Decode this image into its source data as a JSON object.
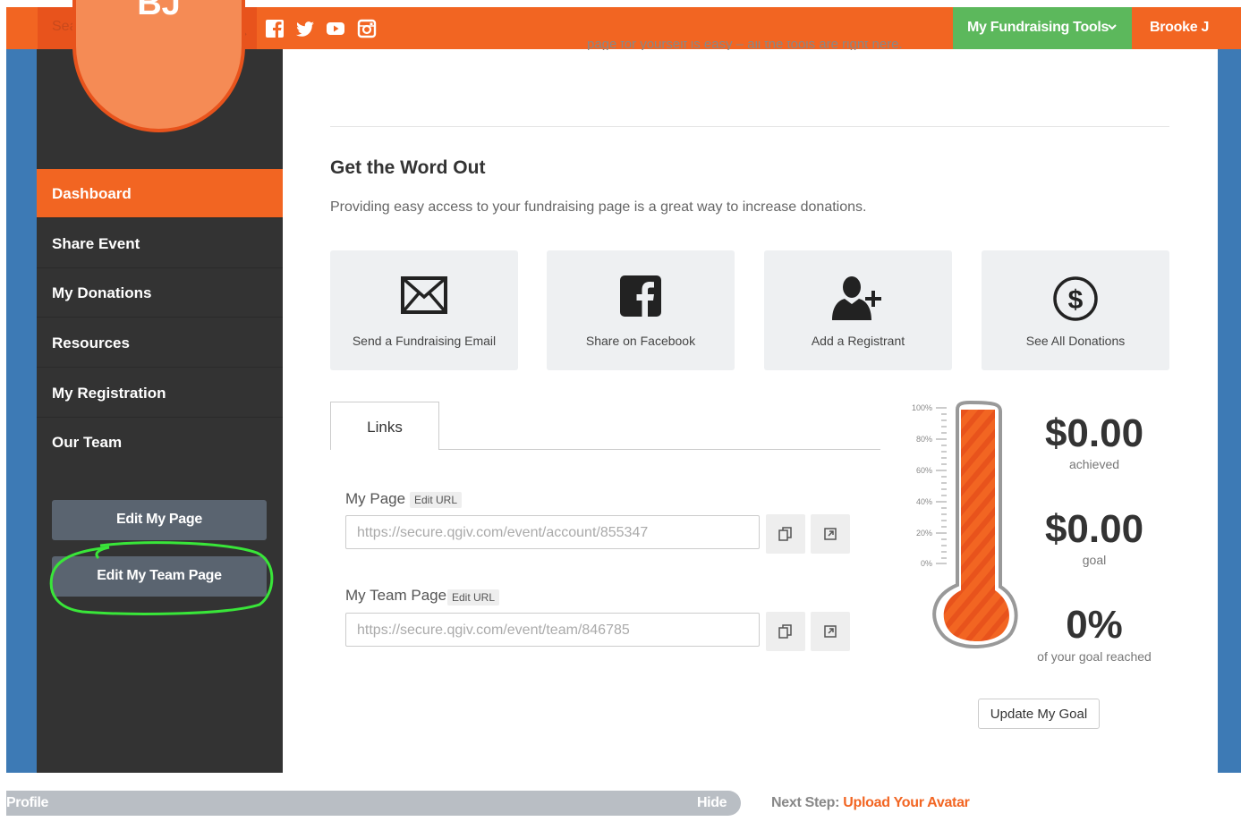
{
  "topbar": {
    "search_placeholder": "Search",
    "social_icons": [
      "facebook-icon",
      "twitter-icon",
      "youtube-icon",
      "instagram-icon"
    ],
    "tools_label": "My Fundraising Tools",
    "user_name": "Brooke J",
    "colors": {
      "bar": "#f26522",
      "tools": "#5cb85c"
    }
  },
  "sidebar": {
    "avatar_initials": "BJ",
    "items": [
      {
        "label": "Dashboard",
        "active": true
      },
      {
        "label": "Share Event",
        "active": false
      },
      {
        "label": "My Donations",
        "active": false
      },
      {
        "label": "Resources",
        "active": false
      },
      {
        "label": "My Registration",
        "active": false
      },
      {
        "label": "Our Team",
        "active": false
      }
    ],
    "edit_page_label": "Edit My Page",
    "edit_team_label": "Edit My Team Page"
  },
  "main": {
    "cut_off_text": "page for yourself is easy – all the tools are right here.",
    "section_title": "Get the Word Out",
    "section_desc": "Providing easy access to your fundraising page is a great way to increase donations.",
    "cards": [
      {
        "label": "Send a Fundraising Email",
        "icon": "envelope-icon"
      },
      {
        "label": "Share on Facebook",
        "icon": "facebook-icon"
      },
      {
        "label": "Add a Registrant",
        "icon": "add-user-icon"
      },
      {
        "label": "See All Donations",
        "icon": "dollar-circle-icon"
      }
    ],
    "tab_label": "Links",
    "my_page_label": "My Page",
    "my_page_url": "https://secure.qgiv.com/event/account/855347",
    "team_page_label": "My Team Page",
    "team_page_url": "https://secure.qgiv.com/event/team/846785",
    "edit_url_label": "Edit URL"
  },
  "goal": {
    "scale_labels": [
      "100%",
      "80%",
      "60%",
      "40%",
      "20%",
      "0%"
    ],
    "achieved_value": "$0.00",
    "achieved_label": "achieved",
    "goal_value": "$0.00",
    "goal_label": "goal",
    "percent_value": "0%",
    "percent_label": "of your goal reached",
    "update_label": "Update My Goal"
  },
  "footer": {
    "profile_label": "Profile",
    "hide_label": "Hide",
    "next_step_prefix": "Next Step:",
    "next_step_link": "Upload Your Avatar"
  }
}
